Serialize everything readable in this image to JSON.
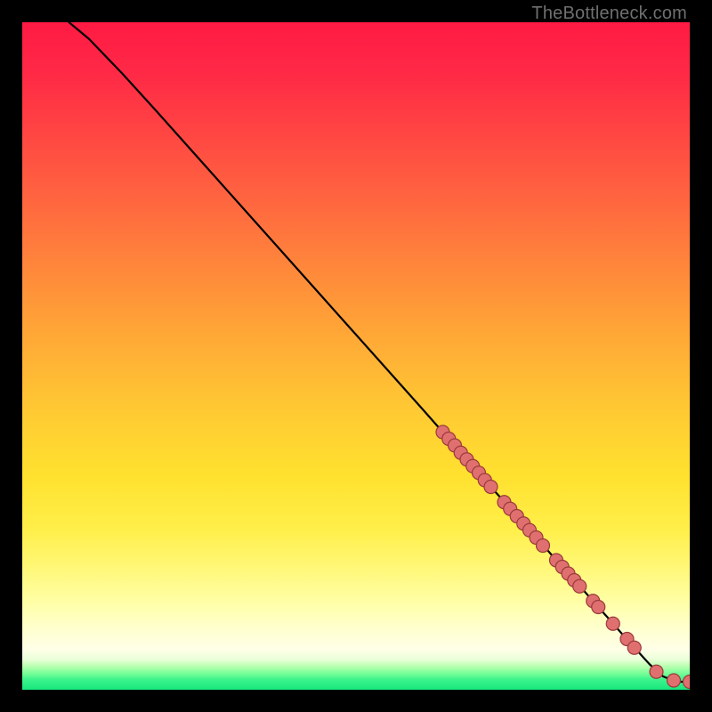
{
  "attribution": "TheBottleneck.com",
  "colors": {
    "dot_fill": "#e07070",
    "dot_stroke": "#9a3a3a",
    "curve": "#000000",
    "frame_bg": "#000000"
  },
  "chart_data": {
    "type": "line",
    "title": "",
    "xlabel": "",
    "ylabel": "",
    "xlim": [
      0,
      100
    ],
    "ylim": [
      0,
      100
    ],
    "grid": false,
    "legend": false,
    "series": [
      {
        "name": "curve",
        "x": [
          7,
          10,
          15,
          20,
          25,
          30,
          35,
          40,
          45,
          50,
          55,
          60,
          63,
          65,
          68,
          70,
          72,
          74,
          76,
          78,
          80,
          82,
          84,
          86,
          88,
          90,
          92,
          94,
          96,
          98,
          100
        ],
        "y": [
          100,
          97.5,
          92.3,
          86.8,
          81.2,
          75.6,
          70.0,
          64.4,
          58.8,
          53.2,
          47.6,
          42.0,
          38.6,
          36.4,
          32.9,
          30.6,
          28.4,
          26.2,
          23.9,
          21.7,
          19.4,
          17.2,
          15.0,
          12.7,
          10.5,
          8.2,
          6.0,
          3.8,
          2.0,
          1.2,
          1.2
        ]
      }
    ],
    "points": [
      {
        "x": 63.0,
        "y": 38.6
      },
      {
        "x": 63.9,
        "y": 37.6
      },
      {
        "x": 64.8,
        "y": 36.6
      },
      {
        "x": 65.7,
        "y": 35.5
      },
      {
        "x": 66.6,
        "y": 34.5
      },
      {
        "x": 67.5,
        "y": 33.5
      },
      {
        "x": 68.4,
        "y": 32.5
      },
      {
        "x": 69.3,
        "y": 31.4
      },
      {
        "x": 70.2,
        "y": 30.4
      },
      {
        "x": 72.2,
        "y": 28.1
      },
      {
        "x": 73.1,
        "y": 27.1
      },
      {
        "x": 74.1,
        "y": 26.0
      },
      {
        "x": 75.1,
        "y": 24.9
      },
      {
        "x": 76.0,
        "y": 23.9
      },
      {
        "x": 77.0,
        "y": 22.8
      },
      {
        "x": 78.0,
        "y": 21.6
      },
      {
        "x": 80.0,
        "y": 19.4
      },
      {
        "x": 80.9,
        "y": 18.4
      },
      {
        "x": 81.8,
        "y": 17.4
      },
      {
        "x": 82.7,
        "y": 16.4
      },
      {
        "x": 83.5,
        "y": 15.5
      },
      {
        "x": 85.5,
        "y": 13.3
      },
      {
        "x": 86.3,
        "y": 12.4
      },
      {
        "x": 88.5,
        "y": 9.9
      },
      {
        "x": 90.6,
        "y": 7.6
      },
      {
        "x": 91.7,
        "y": 6.3
      },
      {
        "x": 95.0,
        "y": 2.7
      },
      {
        "x": 97.6,
        "y": 1.4
      },
      {
        "x": 100.0,
        "y": 1.2
      }
    ],
    "dot_radius": 7.5
  }
}
